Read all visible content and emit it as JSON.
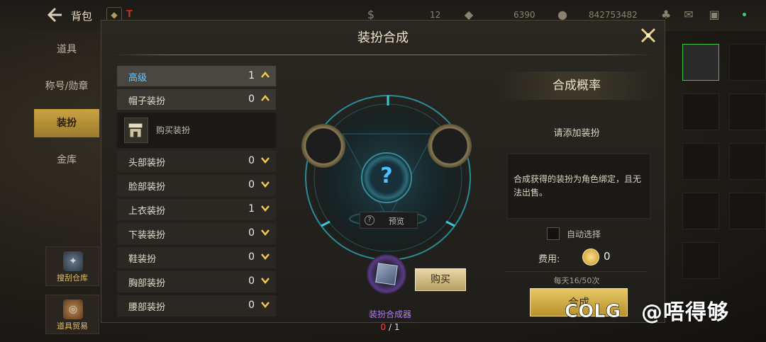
{
  "topbar": {
    "title": "背包",
    "res1": "12",
    "res2": "6390",
    "res3": "842753482"
  },
  "leftnav": {
    "items": [
      {
        "label": "道具"
      },
      {
        "label": "称号/勋章"
      },
      {
        "label": "装扮"
      },
      {
        "label": "金库"
      }
    ],
    "side_btn1": "搜刮仓库",
    "side_btn2": "道具贸易"
  },
  "modal": {
    "title": "装扮合成",
    "categories": [
      {
        "label": "高级",
        "count": "1"
      },
      {
        "label": "帽子装扮",
        "count": "0"
      }
    ],
    "buy_item": {
      "label": "购买装扮"
    },
    "subcategories": [
      {
        "label": "头部装扮",
        "count": "0"
      },
      {
        "label": "脸部装扮",
        "count": "0"
      },
      {
        "label": "上衣装扮",
        "count": "1"
      },
      {
        "label": "下装装扮",
        "count": "0"
      },
      {
        "label": "鞋装扮",
        "count": "0"
      },
      {
        "label": "胸部装扮",
        "count": "0"
      },
      {
        "label": "腰部装扮",
        "count": "0"
      }
    ],
    "center": {
      "preview_label": "预览",
      "buy_label": "购买",
      "synth_name": "装扮合成器",
      "synth_have": "0",
      "synth_need": "/ 1"
    },
    "right": {
      "title": "合成概率",
      "add_prompt": "请添加装扮",
      "info_text": "合成获得的装扮为角色绑定，且无法出售。",
      "auto_select": "自动选择",
      "fee_label": "费用:",
      "fee_value": "0",
      "daily": "每天16/50次",
      "synth_button": "合成"
    }
  },
  "watermark": "@唔得够",
  "watermark_logo": "COLG",
  "colors": {
    "accent_gold": "#c9a243",
    "blue_label": "#6fc6ff",
    "purple_item": "#b07fe8",
    "red_count": "#ff4040"
  }
}
